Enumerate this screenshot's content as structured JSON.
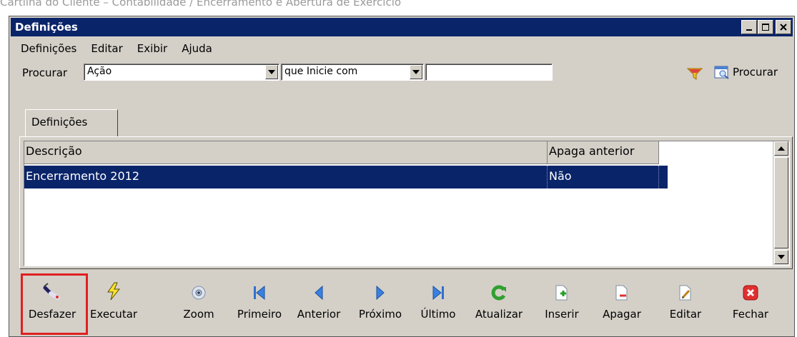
{
  "caption": "Cartilha do Cliente – Contabilidade / Encerramento e Abertura de Exercício",
  "window": {
    "title": "Definições",
    "controls": [
      "minimize-icon",
      "maximize-icon",
      "close-icon"
    ]
  },
  "menu": [
    {
      "label": "Definições",
      "accel": "D"
    },
    {
      "label": "Editar",
      "accel": "E"
    },
    {
      "label": "Exibir",
      "accel": "x"
    },
    {
      "label": "Ajuda",
      "accel": "A"
    }
  ],
  "search": {
    "label": "Procurar",
    "field_value": "Ação",
    "operator_value": "que Inicie com",
    "text_value": "",
    "button_label": "Procurar"
  },
  "tab": {
    "label": "Definições"
  },
  "table": {
    "columns": [
      "Descrição",
      "Apaga anterior"
    ],
    "rows": [
      {
        "descricao": "Encerramento 2012",
        "apaga_anterior": "Não",
        "selected": true
      }
    ]
  },
  "toolbar": [
    {
      "id": "desfazer",
      "label": "Desfazer",
      "icon": "eraser-icon"
    },
    {
      "id": "executar",
      "label": "Executar",
      "icon": "lightning-icon"
    },
    {
      "id": "zoom",
      "label": "Zoom",
      "icon": "zoom-icon"
    },
    {
      "id": "primeiro",
      "label": "Primeiro",
      "icon": "first-icon"
    },
    {
      "id": "anterior",
      "label": "Anterior",
      "icon": "previous-icon"
    },
    {
      "id": "proximo",
      "label": "Próximo",
      "icon": "next-icon"
    },
    {
      "id": "ultimo",
      "label": "Último",
      "icon": "last-icon"
    },
    {
      "id": "atualizar",
      "label": "Atualizar",
      "icon": "refresh-icon"
    },
    {
      "id": "inserir",
      "label": "Inserir",
      "icon": "insert-icon"
    },
    {
      "id": "apagar",
      "label": "Apagar",
      "icon": "delete-icon"
    },
    {
      "id": "editar",
      "label": "Editar",
      "icon": "edit-icon"
    },
    {
      "id": "fechar",
      "label": "Fechar",
      "icon": "close-red-icon"
    }
  ],
  "colors": {
    "titlebar": "#0a246a",
    "selection": "#0a246a",
    "face": "#d4d0c8",
    "highlight_box": "#e02020"
  }
}
